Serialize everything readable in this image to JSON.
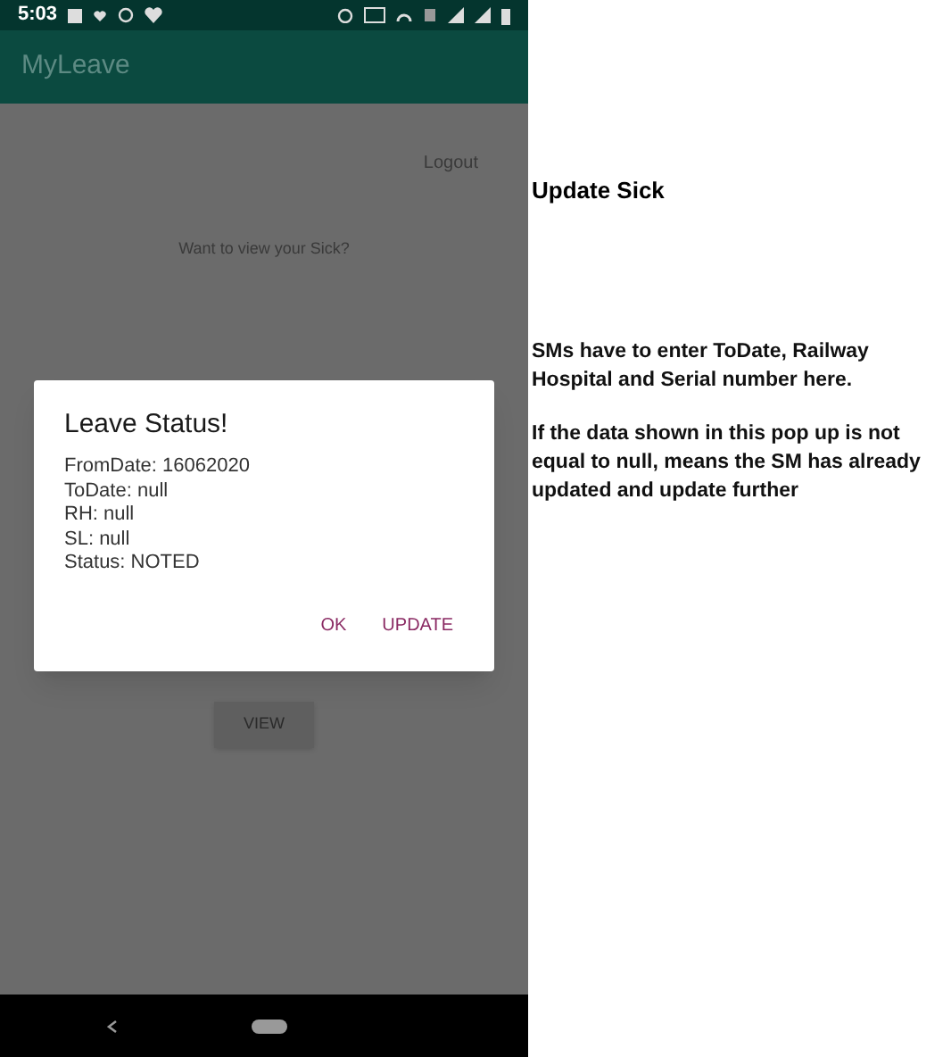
{
  "status_bar": {
    "time": "5:03"
  },
  "app_bar": {
    "title": "MyLeave"
  },
  "screen": {
    "logout": "Logout",
    "prompt": "Want to view your Sick?",
    "view_button": "VIEW"
  },
  "dialog": {
    "title": "Leave Status!",
    "lines": [
      "FromDate: 16062020",
      "ToDate: null",
      "RH: null",
      "SL: null",
      "Status: NOTED"
    ],
    "buttons": [
      "OK",
      "UPDATE"
    ]
  },
  "annotations": {
    "heading": "Update Sick",
    "paragraphs": [
      "SMs have to enter ToDate, Railway Hospital and Serial number here.",
      "If the data shown in this pop up is not equal to null, means the SM has already updated and update further"
    ]
  }
}
